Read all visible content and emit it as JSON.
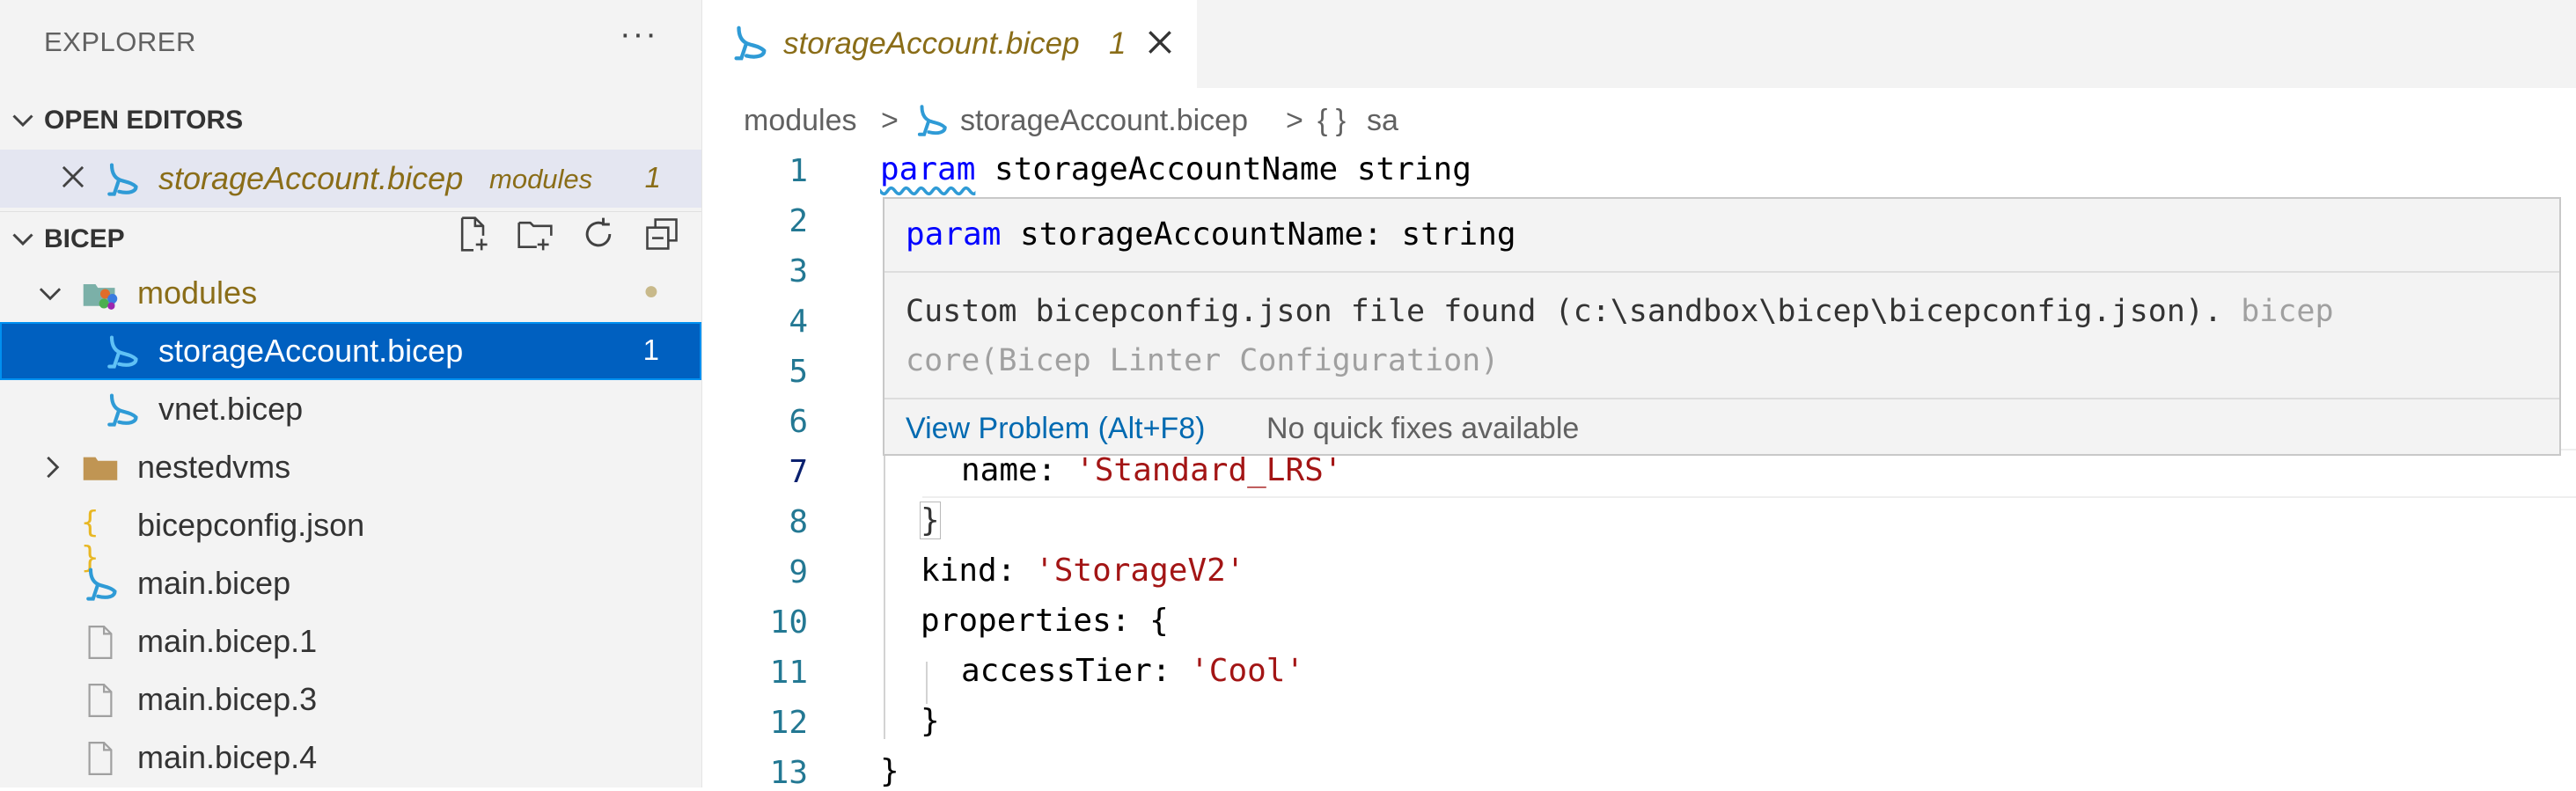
{
  "explorer": {
    "title": "EXPLORER",
    "more_actions": "···",
    "open_editors": {
      "header": "OPEN EDITORS",
      "items": [
        {
          "name": "storageAccount.bicep",
          "folder": "modules",
          "problems": "1"
        }
      ]
    },
    "workspace": {
      "header": "BICEP",
      "tree": [
        {
          "label": "modules",
          "kind": "folder-open",
          "icon": "modules-folder-icon",
          "modified_dot": "●"
        },
        {
          "label": "storageAccount.bicep",
          "kind": "bicep-file",
          "icon": "bicep-icon",
          "problems": "1",
          "selected": true
        },
        {
          "label": "vnet.bicep",
          "kind": "bicep-file",
          "icon": "bicep-icon"
        },
        {
          "label": "nestedvms",
          "kind": "folder",
          "icon": "folder-icon"
        },
        {
          "label": "bicepconfig.json",
          "kind": "json",
          "icon": "json-braces-icon",
          "glyph": "{ }"
        },
        {
          "label": "main.bicep",
          "kind": "bicep-file",
          "icon": "bicep-icon"
        },
        {
          "label": "main.bicep.1",
          "kind": "file",
          "icon": "file-icon"
        },
        {
          "label": "main.bicep.3",
          "kind": "file",
          "icon": "file-icon"
        },
        {
          "label": "main.bicep.4",
          "kind": "file",
          "icon": "file-icon"
        }
      ]
    }
  },
  "editor": {
    "tab": {
      "title": "storageAccount.bicep",
      "problems": "1"
    },
    "breadcrumb": {
      "folder": "modules",
      "sep": ">",
      "file": "storageAccount.bicep",
      "symbol_icon": "{ }",
      "symbol": "sa"
    },
    "line_numbers": [
      "1",
      "2",
      "3",
      "4",
      "5",
      "6",
      "7",
      "8",
      "9",
      "10",
      "11",
      "12",
      "13"
    ],
    "active_line": "7",
    "code": {
      "l1": {
        "kw": "param",
        "rest": " storageAccountName string"
      },
      "l7": {
        "key": "name: ",
        "str": "'Standard_LRS'"
      },
      "l8": "}",
      "l9": {
        "key": "kind: ",
        "str": "'StorageV2'"
      },
      "l10": "properties: {",
      "l11": {
        "key": "accessTier: ",
        "str": "'Cool'"
      },
      "l12": "}",
      "l13": "}"
    },
    "hover": {
      "sig_kw": "param",
      "sig_rest": " storageAccountName: string",
      "message": "Custom bicepconfig.json file found (c:\\sandbox\\bicep\\bicepconfig.json).",
      "source": "bicep core(Bicep Linter Configuration)",
      "view_problem": "View Problem (Alt+F8)",
      "no_fixes": "No quick fixes available"
    }
  },
  "colors": {
    "selection": "#0060c0",
    "modified_italic": "#8a6d18",
    "keyword": "#0000ff",
    "string": "#a31515",
    "line_number": "#237893",
    "bicep_icon": "#2f9bd6"
  }
}
